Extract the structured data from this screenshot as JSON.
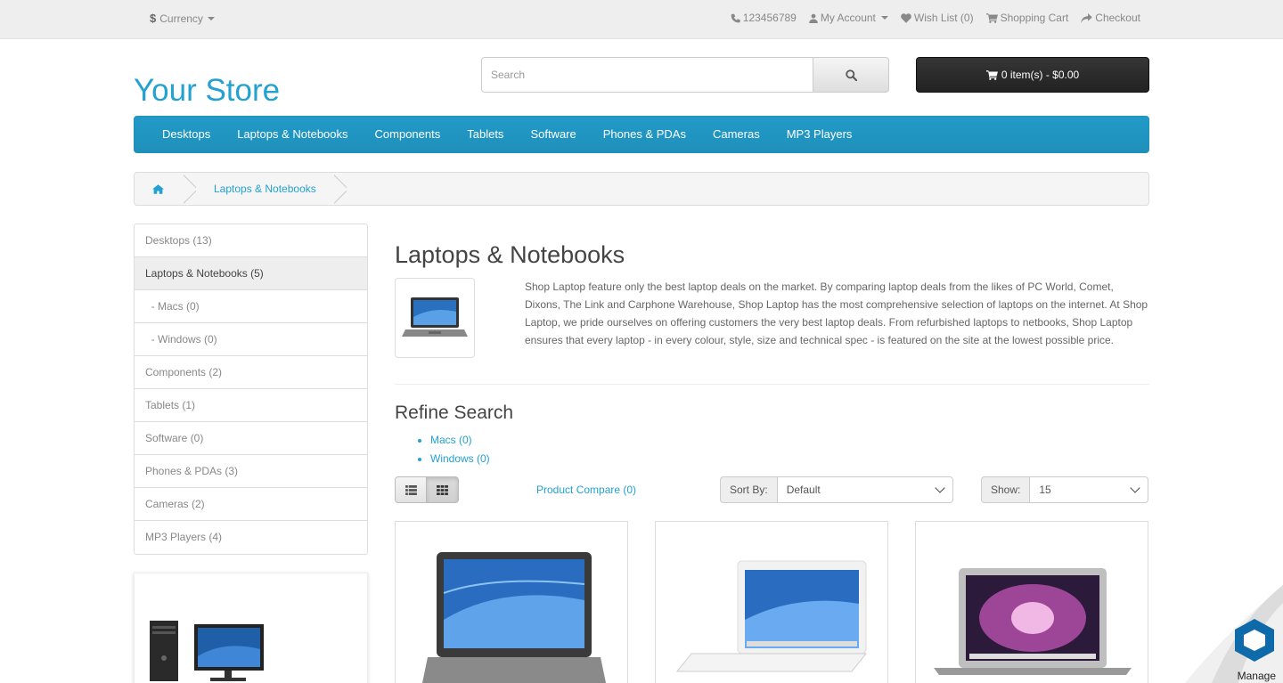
{
  "topbar": {
    "currency_label": "Currency",
    "currency_symbol": "$",
    "phone": "123456789",
    "my_account": "My Account",
    "wishlist": "Wish List (0)",
    "shopping_cart": "Shopping Cart",
    "checkout": "Checkout"
  },
  "header": {
    "logo": "Your Store",
    "search_placeholder": "Search",
    "cart_label": "0 item(s) - $0.00"
  },
  "menu": [
    "Desktops",
    "Laptops & Notebooks",
    "Components",
    "Tablets",
    "Software",
    "Phones & PDAs",
    "Cameras",
    "MP3 Players"
  ],
  "breadcrumb": {
    "current": "Laptops & Notebooks"
  },
  "sidebar": [
    {
      "label": "Desktops (13)",
      "active": false
    },
    {
      "label": "Laptops & Notebooks (5)",
      "active": true
    },
    {
      "label": "&nbsp;&nbsp;- Macs (0)",
      "active": false
    },
    {
      "label": "&nbsp;&nbsp;- Windows (0)",
      "active": false
    },
    {
      "label": "Components (2)",
      "active": false
    },
    {
      "label": "Tablets (1)",
      "active": false
    },
    {
      "label": "Software (0)",
      "active": false
    },
    {
      "label": "Phones & PDAs (3)",
      "active": false
    },
    {
      "label": "Cameras (2)",
      "active": false
    },
    {
      "label": "MP3 Players (4)",
      "active": false
    }
  ],
  "content": {
    "title": "Laptops & Notebooks",
    "description": "Shop Laptop feature only the best laptop deals on the market. By comparing laptop deals from the likes of PC World, Comet, Dixons, The Link and Carphone Warehouse, Shop Laptop has the most comprehensive selection of laptops on the internet. At Shop Laptop, we pride ourselves on offering customers the very best laptop deals. From refurbished laptops to netbooks, Shop Laptop ensures that every laptop - in every colour, style, size and technical spec - is featured on the site at the lowest possible price.",
    "refine_title": "Refine Search",
    "refine_links": [
      "Macs (0)",
      "Windows (0)"
    ],
    "compare_label": "Product Compare (0)",
    "sort_label": "Sort By:",
    "sort_value": "Default",
    "show_label": "Show:",
    "show_value": "15"
  },
  "manage_label": "Manage",
  "colors": {
    "accent": "#23a1d1",
    "menu": "#229ac8"
  }
}
